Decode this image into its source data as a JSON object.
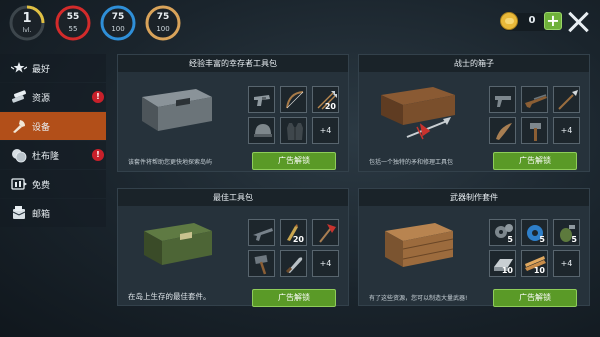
{
  "stats": {
    "level": {
      "value": "1",
      "label": "lvl."
    },
    "health": {
      "value": "55",
      "max": "55",
      "color": "#d32b2b"
    },
    "water": {
      "value": "75",
      "max": "100",
      "color": "#2f8fd8"
    },
    "food": {
      "value": "75",
      "max": "100",
      "color": "#d9a35a"
    }
  },
  "currency": {
    "coins": "0",
    "add_label": "+"
  },
  "sidebar": {
    "items": [
      {
        "label": "最好",
        "alert": ""
      },
      {
        "label": "资源",
        "alert": "!"
      },
      {
        "label": "设备",
        "alert": ""
      },
      {
        "label": "杜布隆",
        "alert": "!"
      },
      {
        "label": "免费",
        "alert": ""
      },
      {
        "label": "邮箱",
        "alert": ""
      }
    ]
  },
  "cards": [
    {
      "title": "经验丰富的幸存者工具包",
      "description": "该套件将帮助您更快地探索岛屿",
      "button": "广告解锁",
      "slots": [
        {
          "icon": "revolver-icon",
          "count": ""
        },
        {
          "icon": "bow-icon",
          "count": ""
        },
        {
          "icon": "arrows-icon",
          "count": "20"
        },
        {
          "icon": "helmet-icon",
          "count": ""
        },
        {
          "icon": "vest-icon",
          "count": ""
        },
        {
          "icon": "more-icon",
          "count": "+4"
        }
      ]
    },
    {
      "title": "战士的箱子",
      "description": "包括一个独特的矛和修理工具包",
      "button": "广告解锁",
      "slots": [
        {
          "icon": "pistol-icon",
          "count": ""
        },
        {
          "icon": "rifle-icon",
          "count": ""
        },
        {
          "icon": "spear-icon",
          "count": ""
        },
        {
          "icon": "blade-icon",
          "count": ""
        },
        {
          "icon": "hammer-icon",
          "count": ""
        },
        {
          "icon": "more-icon",
          "count": "+4"
        }
      ]
    },
    {
      "title": "最佳工具包",
      "description": "在岛上生存的最佳套件。",
      "button": "广告解锁",
      "slots": [
        {
          "icon": "gun-icon",
          "count": ""
        },
        {
          "icon": "cartridges-icon",
          "count": "20"
        },
        {
          "icon": "axe-icon",
          "count": ""
        },
        {
          "icon": "sledgehammer-icon",
          "count": ""
        },
        {
          "icon": "knife-icon",
          "count": ""
        },
        {
          "icon": "more-icon",
          "count": "+4"
        }
      ]
    },
    {
      "title": "武器制作套件",
      "description": "有了这些资源，您可以制造大量武器!",
      "button": "广告解锁",
      "slots": [
        {
          "icon": "gears-icon",
          "count": "5"
        },
        {
          "icon": "tape-icon",
          "count": "5"
        },
        {
          "icon": "grenade-icon",
          "count": "5"
        },
        {
          "icon": "metal-ingot-icon",
          "count": "10"
        },
        {
          "icon": "planks-icon",
          "count": "10"
        },
        {
          "icon": "more-icon",
          "count": "+4"
        }
      ]
    }
  ]
}
